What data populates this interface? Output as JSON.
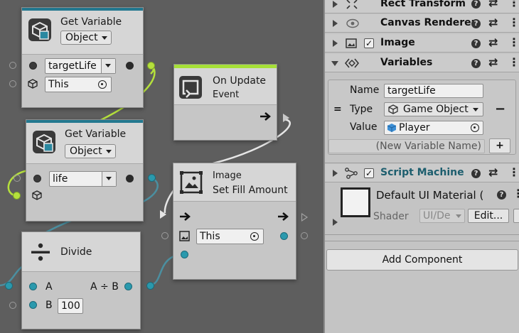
{
  "graph": {
    "get_variable_1": {
      "title": "Get Variable",
      "kind": "Object",
      "name_value": "targetLife",
      "object_value": "This"
    },
    "get_variable_2": {
      "title": "Get Variable",
      "kind": "Object",
      "name_value": "life"
    },
    "on_update": {
      "title": "On Update",
      "subtitle": "Event"
    },
    "set_fill": {
      "category": "Image",
      "title": "Set Fill Amount",
      "target_value": "This"
    },
    "divide": {
      "title": "Divide",
      "input_a": "A",
      "input_b": "B",
      "b_value": "100",
      "output": "A ÷ B"
    }
  },
  "inspector": {
    "rect_transform": "Rect Transform",
    "canvas_renderer": "Canvas Renderer",
    "image": "Image",
    "variables": {
      "title": "Variables",
      "name_label": "Name",
      "name_value": "targetLife",
      "type_label": "Type",
      "type_value": "Game Object",
      "value_label": "Value",
      "value_value": "Player",
      "new_var_placeholder": "(New Variable Name)",
      "add_symbol": "+",
      "remove_symbol": "−",
      "drag_symbol": "="
    },
    "script_machine": "Script Machine",
    "material": {
      "title": "Default UI Material (",
      "shader_label": "Shader",
      "shader_value": "UI/De",
      "edit_label": "Edit..."
    },
    "add_component": "Add Component"
  },
  "colors": {
    "accent_teal": "#23788f",
    "accent_green": "#a6e038",
    "port_teal": "#2a99ad",
    "script_machine_text": "#1d5e6e"
  }
}
